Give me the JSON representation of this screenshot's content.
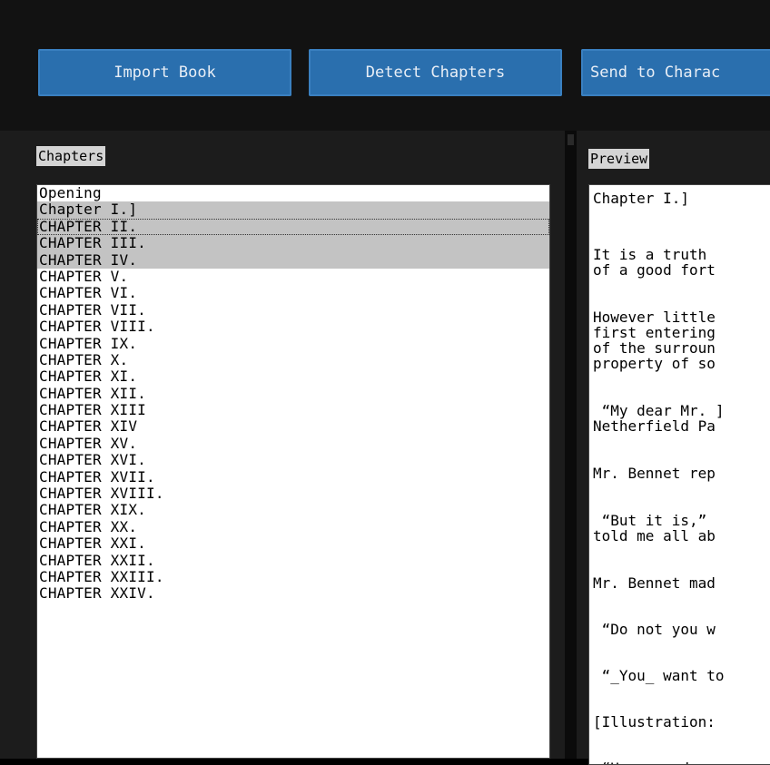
{
  "toolbar": {
    "import_label": "Import Book",
    "detect_label": "Detect Chapters",
    "send_label": "Send to Charac"
  },
  "chapters_panel": {
    "label": "Chapters",
    "items": [
      "Opening",
      "Chapter I.]",
      "CHAPTER II.",
      "CHAPTER III.",
      "CHAPTER IV.",
      "CHAPTER V.",
      "CHAPTER VI.",
      "CHAPTER VII.",
      "CHAPTER VIII.",
      "CHAPTER IX.",
      "CHAPTER X.",
      "CHAPTER XI.",
      "CHAPTER XII.",
      "CHAPTER XIII",
      "CHAPTER XIV",
      "CHAPTER XV.",
      "CHAPTER XVI.",
      "CHAPTER XVII.",
      "CHAPTER XVIII.",
      "CHAPTER XIX.",
      "CHAPTER XX.",
      "CHAPTER XXI.",
      "CHAPTER XXII.",
      "CHAPTER XXIII.",
      "CHAPTER XXIV."
    ],
    "selected_indices": [
      1,
      2,
      3,
      4
    ],
    "focused_index": 2
  },
  "preview_panel": {
    "label": "Preview",
    "lines": [
      "Chapter I.]",
      "It is a truth",
      "of a good fort",
      "However little",
      "first entering",
      "of the surroun",
      "property of so",
      " “My dear Mr. ]",
      "Netherfield Pa",
      "Mr. Bennet rep",
      " “But it is,”",
      "told me all ab",
      "Mr. Bennet mad",
      " “Do not you w",
      " “_You_ want to",
      "[Illustration:",
      " “He came down"
    ]
  },
  "colors": {
    "button_blue": "#2a6fae",
    "selection_gray": "#c3c3c3",
    "background": "#000000"
  }
}
